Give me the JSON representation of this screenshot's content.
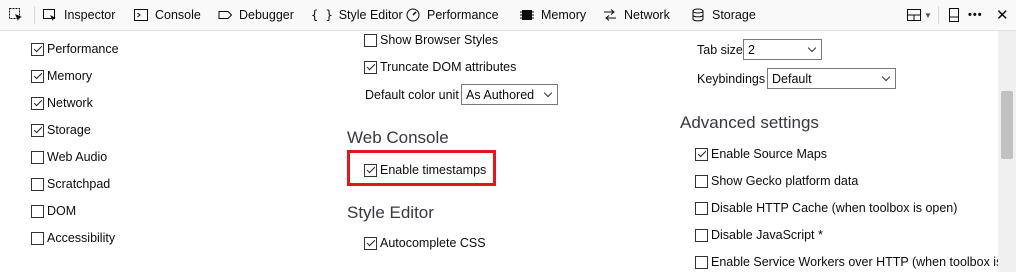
{
  "toolbar": {
    "inspector": "Inspector",
    "console": "Console",
    "debugger": "Debugger",
    "style_editor": "Style Editor",
    "style_editor_glyph": "{ }",
    "performance": "Performance",
    "memory": "Memory",
    "network": "Network",
    "storage": "Storage",
    "close_glyph": "✕",
    "more_glyph": "•••"
  },
  "default_tools": {
    "items": [
      {
        "label": "Performance",
        "checked": true
      },
      {
        "label": "Memory",
        "checked": true
      },
      {
        "label": "Network",
        "checked": true
      },
      {
        "label": "Storage",
        "checked": true
      },
      {
        "label": "Web Audio",
        "checked": false
      },
      {
        "label": "Scratchpad",
        "checked": false
      },
      {
        "label": "DOM",
        "checked": false
      },
      {
        "label": "Accessibility",
        "checked": false
      }
    ]
  },
  "inspector_settings": {
    "show_browser_styles": {
      "label": "Show Browser Styles",
      "checked": false
    },
    "truncate_dom": {
      "label": "Truncate DOM attributes",
      "checked": true
    },
    "color_unit_label": "Default color unit",
    "color_unit_value": "As Authored"
  },
  "web_console": {
    "heading": "Web Console",
    "enable_timestamps": {
      "label": "Enable timestamps",
      "checked": true
    }
  },
  "style_editor": {
    "heading": "Style Editor",
    "autocomplete_css": {
      "label": "Autocomplete CSS",
      "checked": true
    }
  },
  "editor_prefs": {
    "tab_size_label": "Tab size",
    "tab_size_value": "2",
    "keybindings_label": "Keybindings",
    "keybindings_value": "Default"
  },
  "advanced": {
    "heading": "Advanced settings",
    "items": [
      {
        "label": "Enable Source Maps",
        "checked": true
      },
      {
        "label": "Show Gecko platform data",
        "checked": false
      },
      {
        "label": "Disable HTTP Cache (when toolbox is open)",
        "checked": false
      },
      {
        "label": "Disable JavaScript *",
        "checked": false
      },
      {
        "label": "Enable Service Workers over HTTP (when toolbox is",
        "checked": false
      }
    ]
  },
  "colors": {
    "highlight": "#e0171f",
    "toolbar_bg": "#f9f9fa"
  }
}
